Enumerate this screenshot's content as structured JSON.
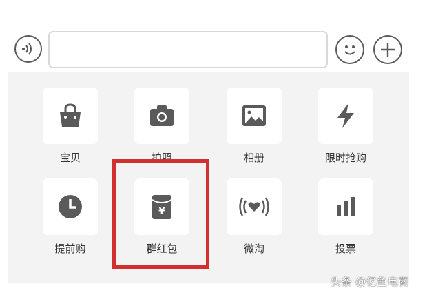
{
  "input_bar": {
    "voice_icon": "voice-wave-icon",
    "emoji_icon": "smiley-icon",
    "plus_icon": "plus-icon",
    "text_value": ""
  },
  "grid": {
    "items": [
      {
        "label": "宝贝",
        "icon": "shopping-bag-icon"
      },
      {
        "label": "拍照",
        "icon": "camera-icon"
      },
      {
        "label": "相册",
        "icon": "picture-icon"
      },
      {
        "label": "限时抢购",
        "icon": "lightning-icon"
      },
      {
        "label": "提前购",
        "icon": "clock-icon"
      },
      {
        "label": "群红包",
        "icon": "red-envelope-icon",
        "glyph": "¥"
      },
      {
        "label": "微淘",
        "icon": "heart-signal-icon"
      },
      {
        "label": "投票",
        "icon": "bar-chart-icon"
      }
    ]
  },
  "highlight": {
    "target": "群红包",
    "color": "#d22f2f"
  },
  "watermark": {
    "text": "头条 @亿鱼电商"
  },
  "colors": {
    "panel_bg": "#f3f3f3",
    "tile_bg": "#ffffff",
    "icon_gray": "#5a5a5a",
    "label": "#333333"
  }
}
